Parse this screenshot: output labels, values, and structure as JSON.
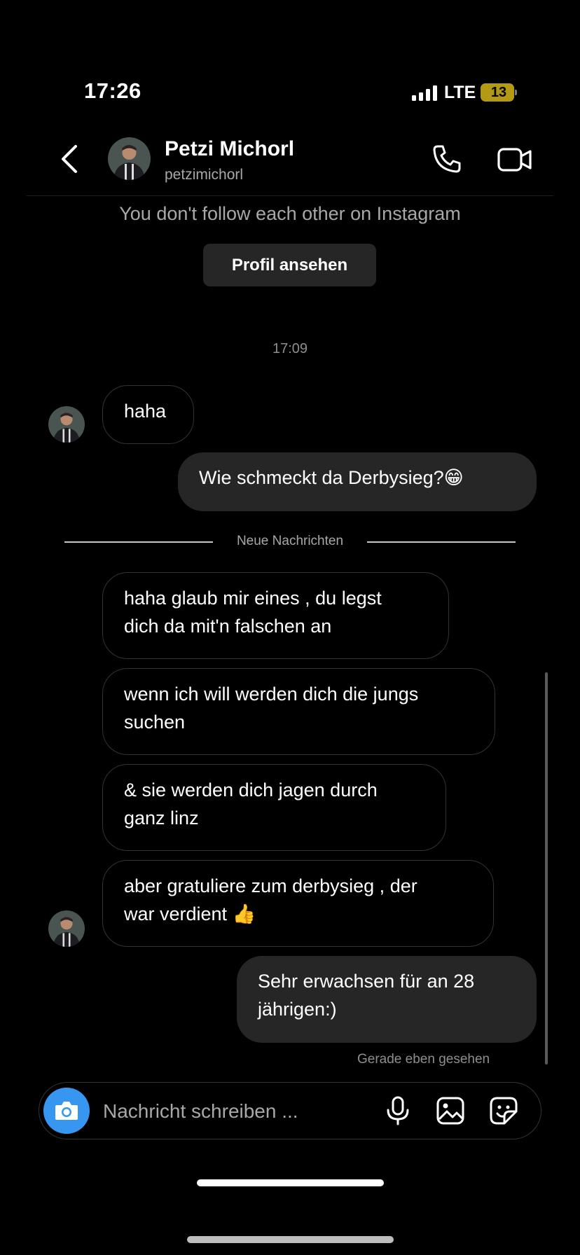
{
  "status_bar": {
    "time": "17:26",
    "network": "LTE",
    "battery": "13"
  },
  "header": {
    "name": "Petzi Michorl",
    "username": "petzimichorl"
  },
  "follow_note": "You don't follow each other on Instagram",
  "profile_button": "Profil ansehen",
  "timestamp": "17:09",
  "divider_label": "Neue Nachrichten",
  "messages": [
    {
      "from": "them",
      "text": "haha"
    },
    {
      "from": "me",
      "text": "Wie schmeckt da Derbysieg?😁"
    },
    {
      "from": "them",
      "lines": [
        "haha glaub mir eines , du legst",
        "dich da mit'n falschen an"
      ]
    },
    {
      "from": "them",
      "lines": [
        "wenn ich will werden dich die jungs",
        "suchen"
      ]
    },
    {
      "from": "them",
      "lines": [
        "& sie werden dich jagen durch",
        "ganz linz"
      ]
    },
    {
      "from": "them",
      "lines": [
        "aber gratuliere zum derbysieg , der",
        "war verdient 👍"
      ]
    },
    {
      "from": "me",
      "lines": [
        "Sehr erwachsen für an 28",
        "jährigen:)"
      ]
    }
  ],
  "seen_status": "Gerade eben gesehen",
  "composer": {
    "placeholder": "Nachricht schreiben ..."
  },
  "icons": {
    "back": "chevron-left-icon",
    "call": "phone-icon",
    "video": "video-camera-icon",
    "camera": "camera-icon",
    "mic": "microphone-icon",
    "gallery": "image-icon",
    "sticker": "sticker-icon"
  },
  "colors": {
    "background": "#000000",
    "accent": "#3797f0",
    "bubble_out": "#262626",
    "battery": "#b49a14"
  }
}
